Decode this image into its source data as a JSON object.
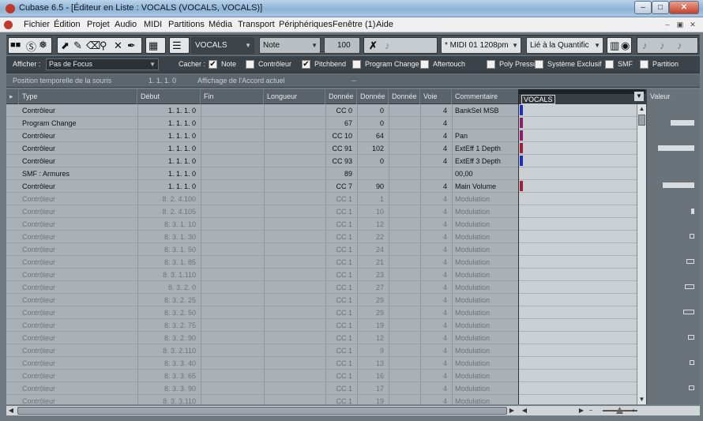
{
  "window": {
    "title": "Cubase 6.5 - [Éditeur en Liste : VOCALS (VOCALS, VOCALS)]",
    "min": "–",
    "max": "□",
    "close": "✕"
  },
  "menu": [
    "Fichier",
    "Édition",
    "Projet",
    "Audio",
    "MIDI",
    "Partitions",
    "Média",
    "Transport",
    "Périphériques",
    "Fenêtre (1)",
    "Aide"
  ],
  "mdi": [
    "–",
    "▣",
    "✕"
  ],
  "toolbar": {
    "track": "VOCALS",
    "event_type": "Note",
    "velocity": "100",
    "midi_input": "* MIDI 01  1208pm",
    "quantize": "Lié à la Quantific"
  },
  "filters": {
    "show_label": "Afficher :",
    "show_value": "Pas de Focus",
    "hide_label": "Cacher :",
    "items": [
      {
        "label": "Note",
        "checked": true
      },
      {
        "label": "Contrôleur",
        "checked": false
      },
      {
        "label": "Pitchbend",
        "checked": true
      },
      {
        "label": "Program Change",
        "checked": false
      },
      {
        "label": "Aftertouch",
        "checked": false
      },
      {
        "label": "Poly Pressure",
        "checked": false
      },
      {
        "label": "Système Exclusif",
        "checked": false
      },
      {
        "label": "SMF",
        "checked": false
      },
      {
        "label": "Partition",
        "checked": false
      }
    ]
  },
  "info": {
    "mouse_pos_label": "Position temporelle de la souris",
    "mouse_pos_value": "1. 1. 1.    0",
    "chord_label": "Affichage de l'Accord actuel",
    "chord_value": "--"
  },
  "columns": [
    "Type",
    "Début",
    "Fin",
    "Longueur",
    "Donnée",
    "Donnée",
    "Donnée",
    "Voie",
    "Commentaire"
  ],
  "rows": [
    {
      "type": "Contrôleur",
      "start": "1. 1. 1.    0",
      "d1": "CC 0",
      "d2": "0",
      "ch": "4",
      "comment": "BankSel MSB",
      "dim": false
    },
    {
      "type": "Program Change",
      "start": "1. 1. 1.    0",
      "d1": "67",
      "d2": "0",
      "ch": "4",
      "comment": "",
      "dim": false
    },
    {
      "type": "Contrôleur",
      "start": "1. 1. 1.    0",
      "d1": "CC 10",
      "d2": "64",
      "ch": "4",
      "comment": "Pan",
      "dim": false
    },
    {
      "type": "Contrôleur",
      "start": "1. 1. 1.    0",
      "d1": "CC 91",
      "d2": "102",
      "ch": "4",
      "comment": "ExtEff 1 Depth",
      "dim": false
    },
    {
      "type": "Contrôleur",
      "start": "1. 1. 1.    0",
      "d1": "CC 93",
      "d2": "0",
      "ch": "4",
      "comment": "ExtEff 3 Depth",
      "dim": false
    },
    {
      "type": "SMF : Armures",
      "start": "1. 1. 1.    0",
      "d1": "89",
      "d2": "",
      "ch": "",
      "comment": "00,00",
      "dim": false
    },
    {
      "type": "Contrôleur",
      "start": "1. 1. 1.    0",
      "d1": "CC 7",
      "d2": "90",
      "ch": "4",
      "comment": "Main Volume",
      "dim": false
    },
    {
      "type": "Contrôleur",
      "start": "8. 2. 4.100",
      "d1": "CC 1",
      "d2": "1",
      "ch": "4",
      "comment": "Modulation",
      "dim": true
    },
    {
      "type": "Contrôleur",
      "start": "8. 2. 4.105",
      "d1": "CC 1",
      "d2": "10",
      "ch": "4",
      "comment": "Modulation",
      "dim": true
    },
    {
      "type": "Contrôleur",
      "start": "8. 3. 1.  10",
      "d1": "CC 1",
      "d2": "12",
      "ch": "4",
      "comment": "Modulation",
      "dim": true
    },
    {
      "type": "Contrôleur",
      "start": "8. 3. 1.  30",
      "d1": "CC 1",
      "d2": "22",
      "ch": "4",
      "comment": "Modulation",
      "dim": true
    },
    {
      "type": "Contrôleur",
      "start": "8. 3. 1.  50",
      "d1": "CC 1",
      "d2": "24",
      "ch": "4",
      "comment": "Modulation",
      "dim": true
    },
    {
      "type": "Contrôleur",
      "start": "8. 3. 1.  85",
      "d1": "CC 1",
      "d2": "21",
      "ch": "4",
      "comment": "Modulation",
      "dim": true
    },
    {
      "type": "Contrôleur",
      "start": "8. 3. 1.110",
      "d1": "CC 1",
      "d2": "23",
      "ch": "4",
      "comment": "Modulation",
      "dim": true
    },
    {
      "type": "Contrôleur",
      "start": "8. 3. 2.    0",
      "d1": "CC 1",
      "d2": "27",
      "ch": "4",
      "comment": "Modulation",
      "dim": true
    },
    {
      "type": "Contrôleur",
      "start": "8. 3. 2.  25",
      "d1": "CC 1",
      "d2": "29",
      "ch": "4",
      "comment": "Modulation",
      "dim": true
    },
    {
      "type": "Contrôleur",
      "start": "8. 3. 2.  50",
      "d1": "CC 1",
      "d2": "29",
      "ch": "4",
      "comment": "Modulation",
      "dim": true
    },
    {
      "type": "Contrôleur",
      "start": "8. 3. 2.  75",
      "d1": "CC 1",
      "d2": "19",
      "ch": "4",
      "comment": "Modulation",
      "dim": true
    },
    {
      "type": "Contrôleur",
      "start": "8. 3. 2.  90",
      "d1": "CC 1",
      "d2": "12",
      "ch": "4",
      "comment": "Modulation",
      "dim": true
    },
    {
      "type": "Contrôleur",
      "start": "8. 3. 2.110",
      "d1": "CC 1",
      "d2": "9",
      "ch": "4",
      "comment": "Modulation",
      "dim": true
    },
    {
      "type": "Contrôleur",
      "start": "8. 3. 3.  40",
      "d1": "CC 1",
      "d2": "13",
      "ch": "4",
      "comment": "Modulation",
      "dim": true
    },
    {
      "type": "Contrôleur",
      "start": "8. 3. 3.  65",
      "d1": "CC 1",
      "d2": "16",
      "ch": "4",
      "comment": "Modulation",
      "dim": true
    },
    {
      "type": "Contrôleur",
      "start": "8. 3. 3.  90",
      "d1": "CC 1",
      "d2": "17",
      "ch": "4",
      "comment": "Modulation",
      "dim": true
    },
    {
      "type": "Contrôleur",
      "start": "8. 3. 3.110",
      "d1": "CC 1",
      "d2": "19",
      "ch": "4",
      "comment": "Modulation",
      "dim": true
    }
  ],
  "right_pane": {
    "track_tab": "VOCALS",
    "value_header": "Valeur"
  },
  "marker_colors": [
    "#1f2fb8",
    "#8a1f6e",
    "#8a1f6e",
    "#a0203a",
    "#1f2fb8",
    "#d0d0d0",
    "#a0203a"
  ]
}
